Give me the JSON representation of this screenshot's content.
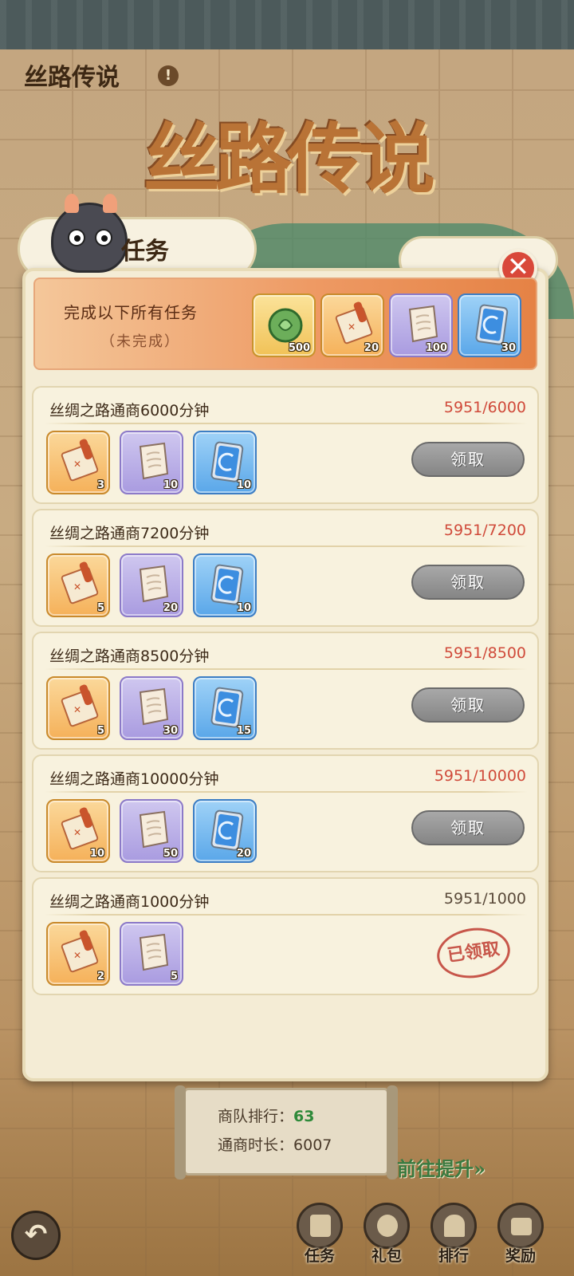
{
  "header": {
    "title": "丝路传说",
    "info_glyph": "!"
  },
  "scene": {
    "banner_title": "丝路传说"
  },
  "panel": {
    "title": "任务",
    "close_glyph": "✕"
  },
  "summary": {
    "title": "完成以下所有任务",
    "status": "（未完成）",
    "rewards": [
      {
        "icon": "jade-token-icon",
        "kind": "green",
        "count": "500"
      },
      {
        "icon": "map-scroll-icon",
        "kind": "orange",
        "count": "20"
      },
      {
        "icon": "paper-scroll-icon",
        "kind": "purple",
        "count": "100"
      },
      {
        "icon": "blue-card-icon",
        "kind": "blue",
        "count": "30"
      }
    ]
  },
  "tasks": [
    {
      "name": "丝绸之路通商6000分钟",
      "progress": "5951/6000",
      "action": "领取",
      "rewards": [
        {
          "icon": "map-scroll-icon",
          "count": "3"
        },
        {
          "icon": "paper-scroll-icon",
          "count": "10"
        },
        {
          "icon": "blue-card-icon",
          "count": "10"
        }
      ]
    },
    {
      "name": "丝绸之路通商7200分钟",
      "progress": "5951/7200",
      "action": "领取",
      "rewards": [
        {
          "icon": "map-scroll-icon",
          "count": "5"
        },
        {
          "icon": "paper-scroll-icon",
          "count": "20"
        },
        {
          "icon": "blue-card-icon",
          "count": "10"
        }
      ]
    },
    {
      "name": "丝绸之路通商8500分钟",
      "progress": "5951/8500",
      "action": "领取",
      "rewards": [
        {
          "icon": "map-scroll-icon",
          "count": "5"
        },
        {
          "icon": "paper-scroll-icon",
          "count": "30"
        },
        {
          "icon": "blue-card-icon",
          "count": "15"
        }
      ]
    },
    {
      "name": "丝绸之路通商10000分钟",
      "progress": "5951/10000",
      "action": "领取",
      "rewards": [
        {
          "icon": "map-scroll-icon",
          "count": "10"
        },
        {
          "icon": "paper-scroll-icon",
          "count": "50"
        },
        {
          "icon": "blue-card-icon",
          "count": "20"
        }
      ]
    },
    {
      "name": "丝绸之路通商1000分钟",
      "progress": "5951/1000",
      "action": "已领取",
      "rewards": [
        {
          "icon": "map-scroll-icon",
          "count": "2"
        },
        {
          "icon": "paper-scroll-icon",
          "count": "5"
        }
      ]
    }
  ],
  "stats": {
    "rank_label": "商队排行：",
    "rank_value": "63",
    "duration_label": "通商时长：",
    "duration_value": "6007"
  },
  "go_improve": "前往提升»",
  "back_glyph": "↶",
  "nav": [
    {
      "label": "任务",
      "icon": "task-scroll-icon"
    },
    {
      "label": "礼包",
      "icon": "gift-bag-icon"
    },
    {
      "label": "排行",
      "icon": "ranking-icon"
    },
    {
      "label": "奖励",
      "icon": "reward-chest-icon"
    }
  ]
}
